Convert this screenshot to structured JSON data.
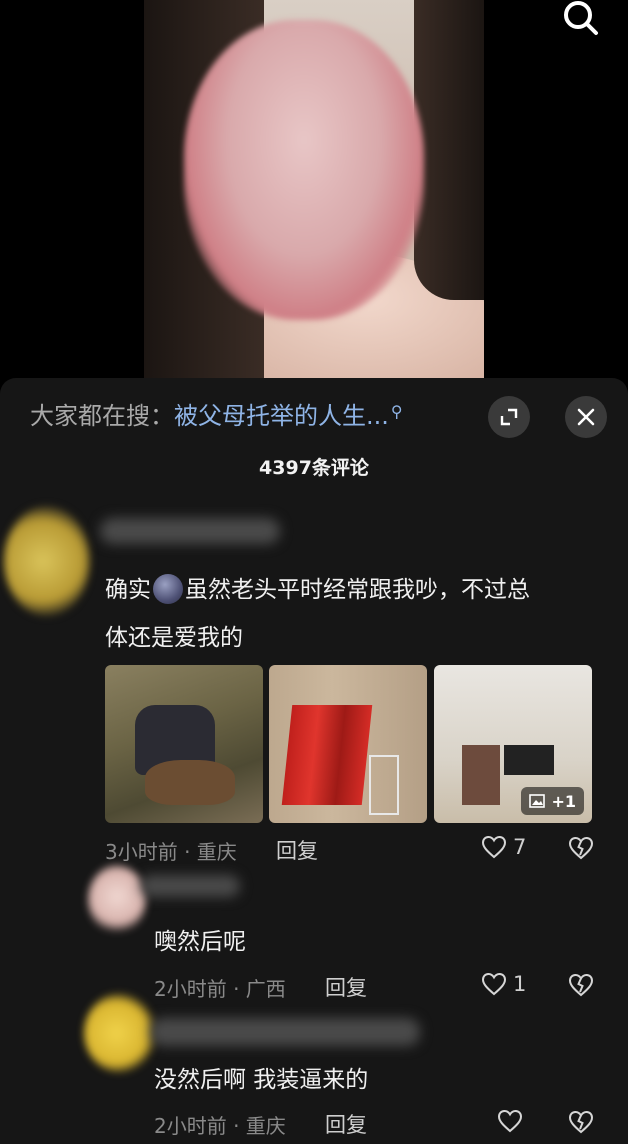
{
  "video": {
    "search_icon": "search-icon"
  },
  "sheet": {
    "trending_prefix": "大家都在搜：",
    "trending_query": "被父母托举的人生...",
    "trending_icon": "search-small-icon",
    "expand_icon": "expand-icon",
    "close_icon": "close-icon",
    "comment_count": "4397条评论"
  },
  "comments": [
    {
      "text_part1": "确实",
      "emoji": "moon-face-emoji",
      "text_part2": "虽然老头平时经常跟我吵，不过总",
      "text_line2": "体还是爱我的",
      "images_extra": "+1",
      "time_location": "3小时前 · 重庆",
      "reply_label": "回复",
      "likes": "7"
    },
    {
      "text": "噢然后呢",
      "time_location": "2小时前 · 广西",
      "reply_label": "回复",
      "likes": "1"
    },
    {
      "text": "没然后啊 我装逼来的",
      "time_location": "2小时前 · 重庆",
      "reply_label": "回复",
      "likes": ""
    }
  ],
  "colors": {
    "sheet_bg": "#161616",
    "link": "#8fb4e6",
    "meta": "#8a8a8a"
  }
}
